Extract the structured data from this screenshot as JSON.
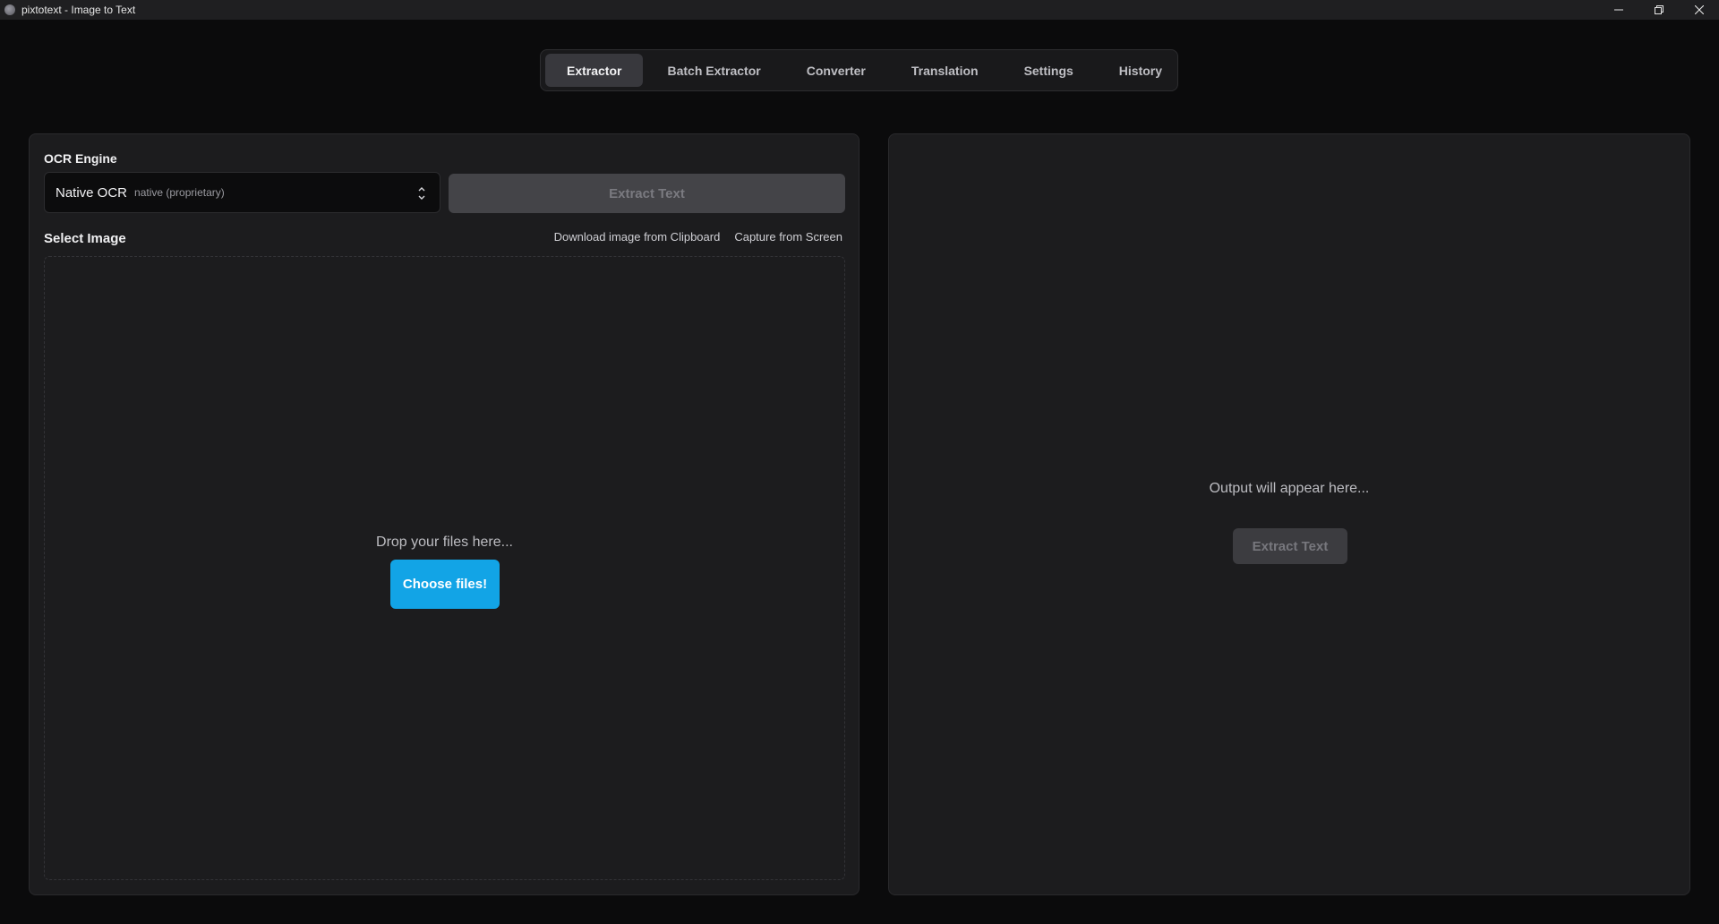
{
  "window": {
    "title": "pixtotext - Image to Text",
    "icon": "app-icon",
    "controls": [
      "minimize-icon",
      "restore-icon",
      "close-icon"
    ]
  },
  "tabs": [
    {
      "label": "Extractor",
      "active": true
    },
    {
      "label": "Batch Extractor",
      "active": false
    },
    {
      "label": "Converter",
      "active": false
    },
    {
      "label": "Translation",
      "active": false
    },
    {
      "label": "Settings",
      "active": false
    },
    {
      "label": "History",
      "active": false
    }
  ],
  "extractor": {
    "ocr_engine_label": "OCR Engine",
    "engine_selected": "Native OCR",
    "engine_selected_sub": "native (proprietary)",
    "extract_button": "Extract Text",
    "select_image_label": "Select Image",
    "clipboard_link": "Download image from Clipboard",
    "capture_link": "Capture from Screen",
    "drop_text": "Drop your files here...",
    "choose_button": "Choose files!"
  },
  "output": {
    "placeholder": "Output will appear here...",
    "extract_button": "Extract Text"
  },
  "colors": {
    "accent": "#12a4e6",
    "background": "#0b0b0c",
    "panel": "#1c1c1e"
  }
}
